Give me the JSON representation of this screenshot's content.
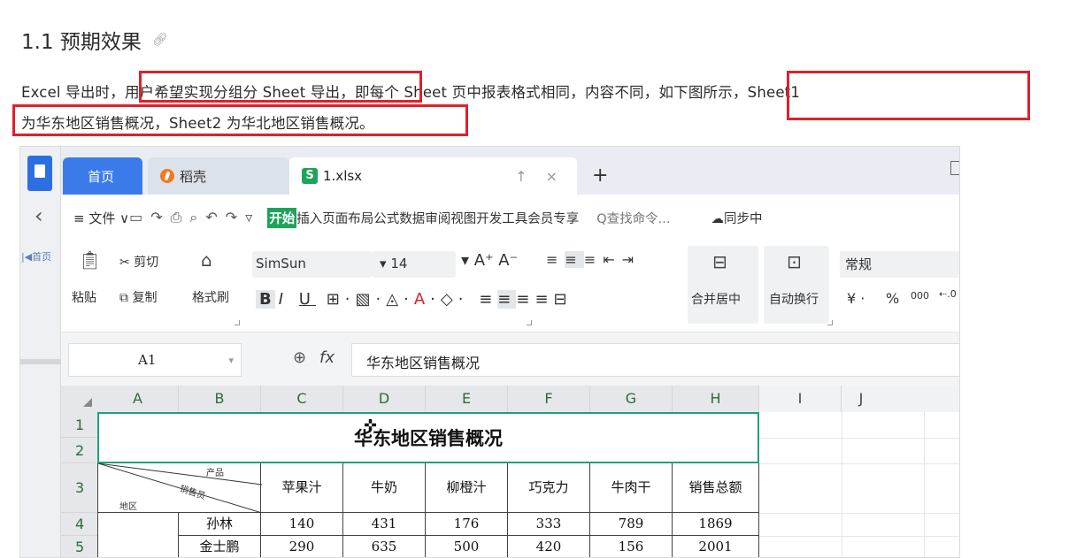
{
  "doc": {
    "title": "1.1 预期效果",
    "anchor_icon": "link-icon",
    "para1": {
      "a": "Excel 导出时，",
      "hl1": "用户希望实现分组分 Sheet 导出，",
      "b": "即每个 Sheet 页中报表格式相同，内容不同，",
      "hl2": "如下图所示，Sheet1"
    },
    "para2": "为华东地区销售概况，Sheet2 为华北地区销售概况。",
    "highlight_color": "#e0202a"
  },
  "app": {
    "left_home": "首页",
    "tabs": [
      "首页",
      "稻壳",
      "1.xlsx"
    ],
    "tab_controls": "↑ ×",
    "tab_add": "+",
    "menu": {
      "file": "≡ 文件 ∨",
      "start": "开始",
      "items": "插入页面布局公式数据审阅视图开发工具会员专享",
      "search": "Q查找命令...",
      "sync": "☁同步中"
    },
    "ribbon": {
      "paste": "粘贴",
      "cut": "剪切",
      "copy": "复制",
      "format_painter": "格式刷",
      "font": "SimSun",
      "size": "14",
      "merge": "合并居中",
      "wrap": "自动换行",
      "number_format": "常规",
      "currency": "¥",
      "percent": "%",
      "thousands": "000",
      "accent": "#1ea35a"
    },
    "formula": {
      "cell_ref": "A1",
      "fx": "fx",
      "content": "华东地区销售概况"
    },
    "sheet": {
      "columns": [
        "A",
        "B",
        "C",
        "D",
        "E",
        "F",
        "G",
        "H",
        "I",
        "J"
      ],
      "rows": [
        "1",
        "2",
        "3",
        "4",
        "5"
      ],
      "title": "华东地区销售概况",
      "diag_product": "产品",
      "diag_sales": "销售员",
      "diag_region": "地区",
      "headers": [
        "苹果汁",
        "牛奶",
        "柳橙汁",
        "巧克力",
        "牛肉干",
        "销售总额"
      ],
      "data": [
        {
          "name": "孙林",
          "values": [
            "140",
            "431",
            "176",
            "333",
            "789",
            "1869"
          ]
        },
        {
          "name": "金士鹏",
          "values": [
            "290",
            "635",
            "500",
            "420",
            "156",
            "2001"
          ]
        }
      ]
    }
  }
}
